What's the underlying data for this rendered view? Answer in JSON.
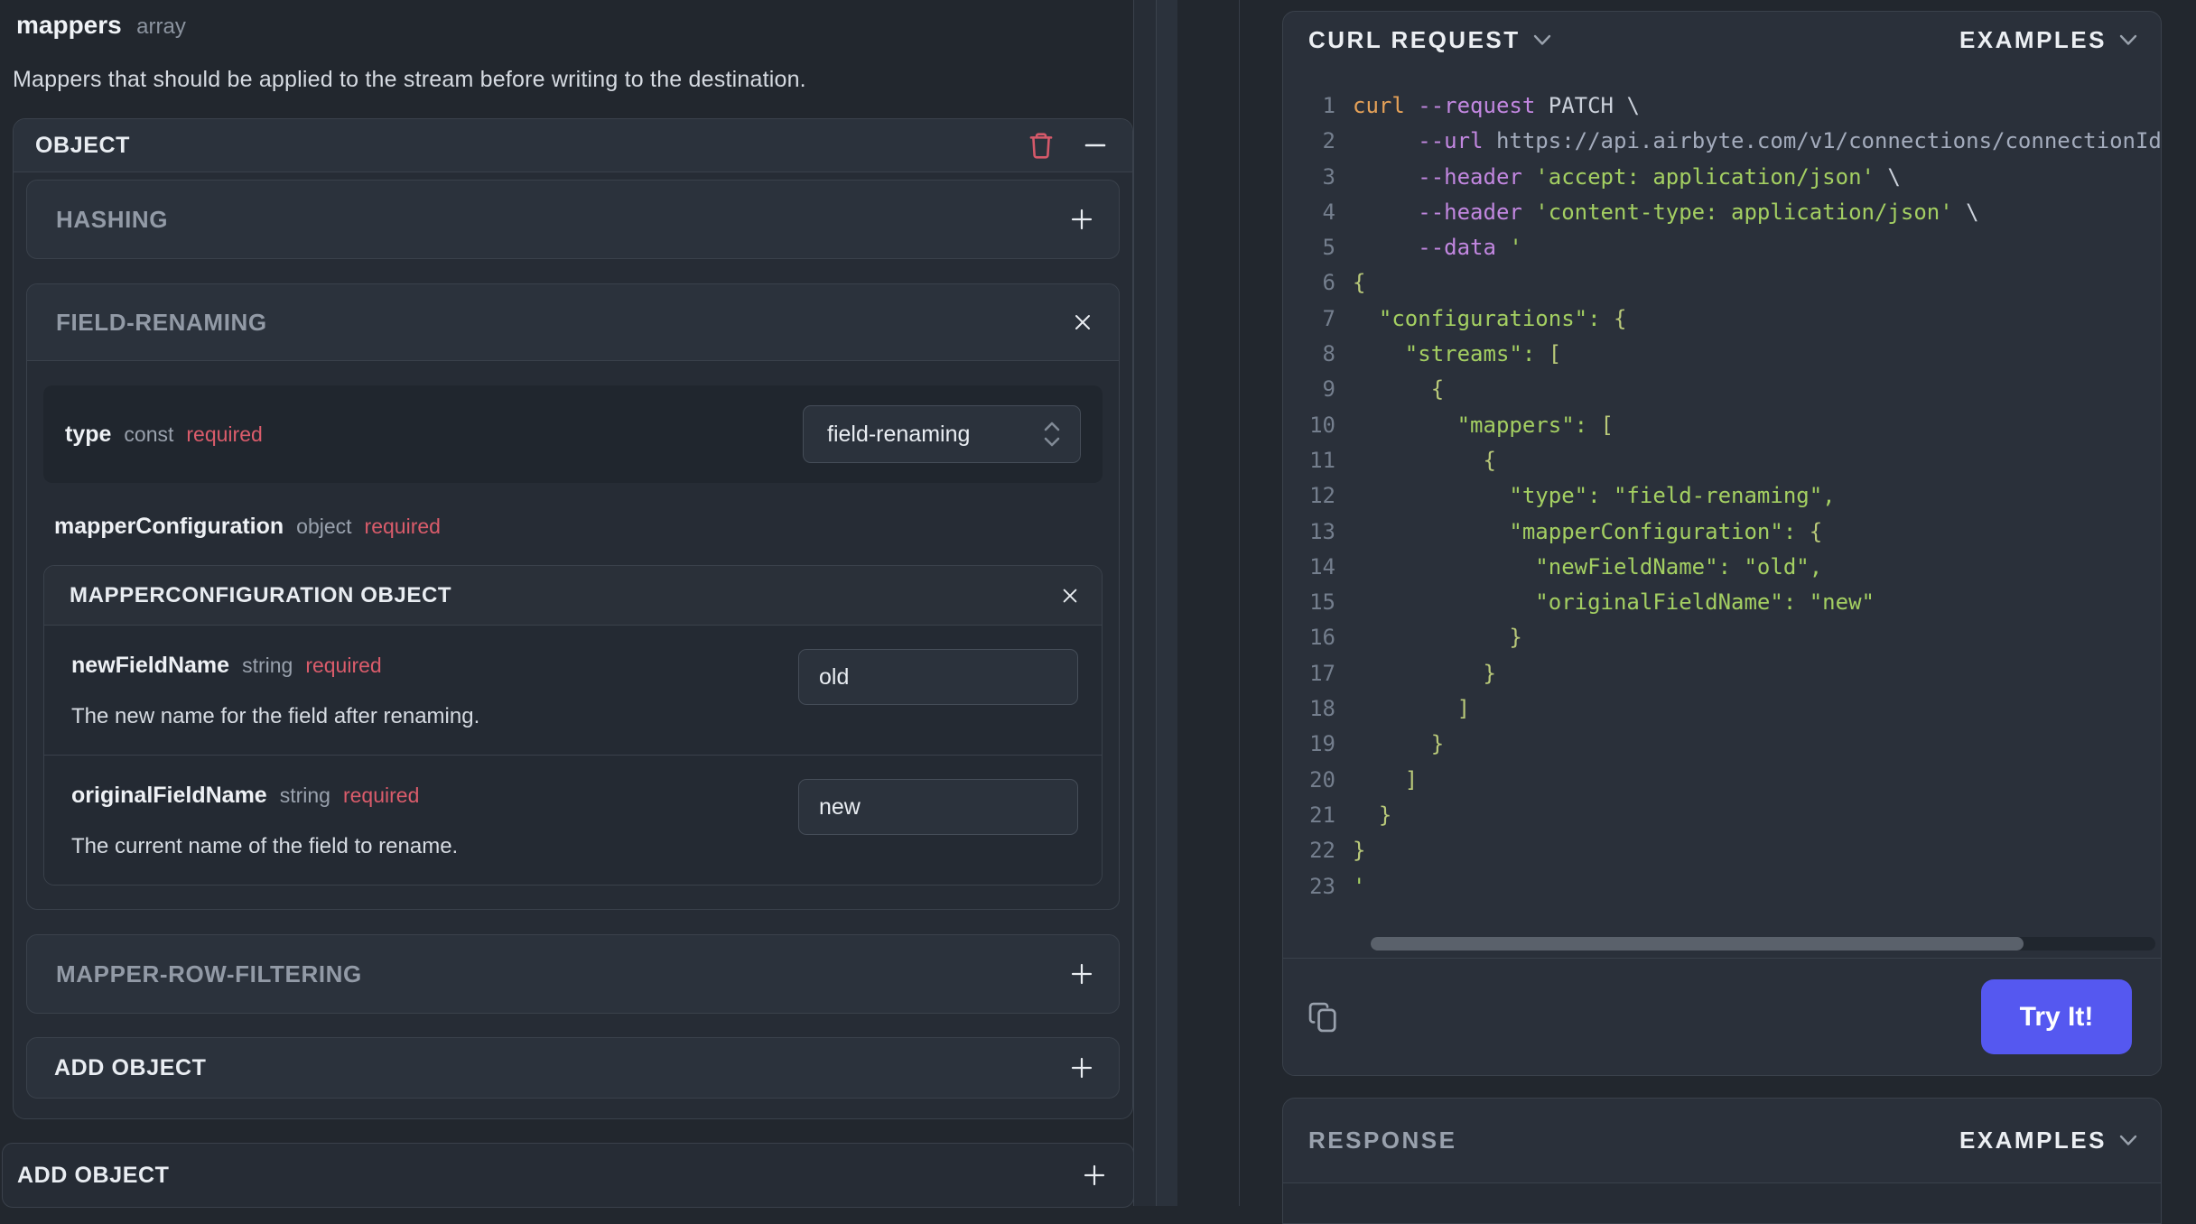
{
  "left_panel": {
    "field": {
      "name": "mappers",
      "type": "array",
      "description": "Mappers that should be applied to the stream before writing to the destination."
    },
    "object_card": {
      "header": "OBJECT",
      "hashing": {
        "label": "HASHING"
      },
      "field_renaming": {
        "label": "FIELD-RENAMING",
        "type_row": {
          "label": "type",
          "meta": "const",
          "required": "required",
          "value": "field-renaming"
        },
        "mapper_configuration": {
          "label": "mapperConfiguration",
          "meta": "object",
          "required": "required",
          "card": {
            "header": "MAPPERCONFIGURATION OBJECT",
            "fields": [
              {
                "label": "newFieldName",
                "meta": "string",
                "required": "required",
                "value": "old",
                "description": "The new name for the field after renaming."
              },
              {
                "label": "originalFieldName",
                "meta": "string",
                "required": "required",
                "value": "new",
                "description": "The current name of the field to rename."
              }
            ]
          }
        }
      },
      "mapper_row_filtering": {
        "label": "MAPPER-ROW-FILTERING"
      },
      "add_object": {
        "label": "ADD OBJECT"
      }
    },
    "add_object_bottom": {
      "label": "ADD OBJECT"
    }
  },
  "request_panel": {
    "title": "CURL REQUEST",
    "examples_label": "EXAMPLES",
    "try_it_label": "Try It!",
    "icons": [
      "chevron-down-icon",
      "copy-icon",
      "trash-icon",
      "plus-icon",
      "minus-icon",
      "close-icon",
      "select-updown-icon"
    ],
    "code": {
      "language": "curl",
      "lines": [
        [
          [
            "cmd",
            "curl "
          ],
          [
            "flag",
            "--request"
          ],
          [
            "plain",
            " PATCH \\"
          ]
        ],
        [
          [
            "plain",
            "     "
          ],
          [
            "flag",
            "--url"
          ],
          [
            "url",
            " https://api.airbyte.com/v1/connections/connectionId"
          ]
        ],
        [
          [
            "plain",
            "     "
          ],
          [
            "flag",
            "--header"
          ],
          [
            "str",
            " 'accept: application/json'"
          ],
          [
            "plain",
            " \\"
          ]
        ],
        [
          [
            "plain",
            "     "
          ],
          [
            "flag",
            "--header"
          ],
          [
            "str",
            " 'content-type: application/json'"
          ],
          [
            "plain",
            " \\"
          ]
        ],
        [
          [
            "plain",
            "     "
          ],
          [
            "flag",
            "--data"
          ],
          [
            "str",
            " '"
          ]
        ],
        [
          [
            "brace",
            "{"
          ]
        ],
        [
          [
            "str",
            "  \"configurations\":"
          ],
          [
            "brace",
            " {"
          ]
        ],
        [
          [
            "str",
            "    \"streams\":"
          ],
          [
            "brace",
            " ["
          ]
        ],
        [
          [
            "brace",
            "      {"
          ]
        ],
        [
          [
            "str",
            "        \"mappers\":"
          ],
          [
            "brace",
            " ["
          ]
        ],
        [
          [
            "brace",
            "          {"
          ]
        ],
        [
          [
            "str",
            "            \"type\": \"field-renaming\","
          ]
        ],
        [
          [
            "str",
            "            \"mapperConfiguration\":"
          ],
          [
            "brace",
            " {"
          ]
        ],
        [
          [
            "str",
            "              \"newFieldName\": \"old\","
          ]
        ],
        [
          [
            "str",
            "              \"originalFieldName\": \"new\""
          ]
        ],
        [
          [
            "brace",
            "            }"
          ]
        ],
        [
          [
            "brace",
            "          }"
          ]
        ],
        [
          [
            "brace",
            "        ]"
          ]
        ],
        [
          [
            "brace",
            "      }"
          ]
        ],
        [
          [
            "brace",
            "    ]"
          ]
        ],
        [
          [
            "brace",
            "  }"
          ]
        ],
        [
          [
            "brace",
            "}"
          ]
        ],
        [
          [
            "str",
            "'"
          ]
        ]
      ]
    }
  },
  "response_panel": {
    "title": "RESPONSE",
    "examples_label": "EXAMPLES"
  },
  "colors": {
    "background": "#22272e",
    "card": "#2b323c",
    "card_dark": "#262c35",
    "border": "#3a414b",
    "accent_button": "#5558f0",
    "required_red": "#da5c6b",
    "code_string_green": "#a4cf62",
    "code_flag_purple": "#c287e0",
    "code_cmd_orange": "#e5a158"
  }
}
